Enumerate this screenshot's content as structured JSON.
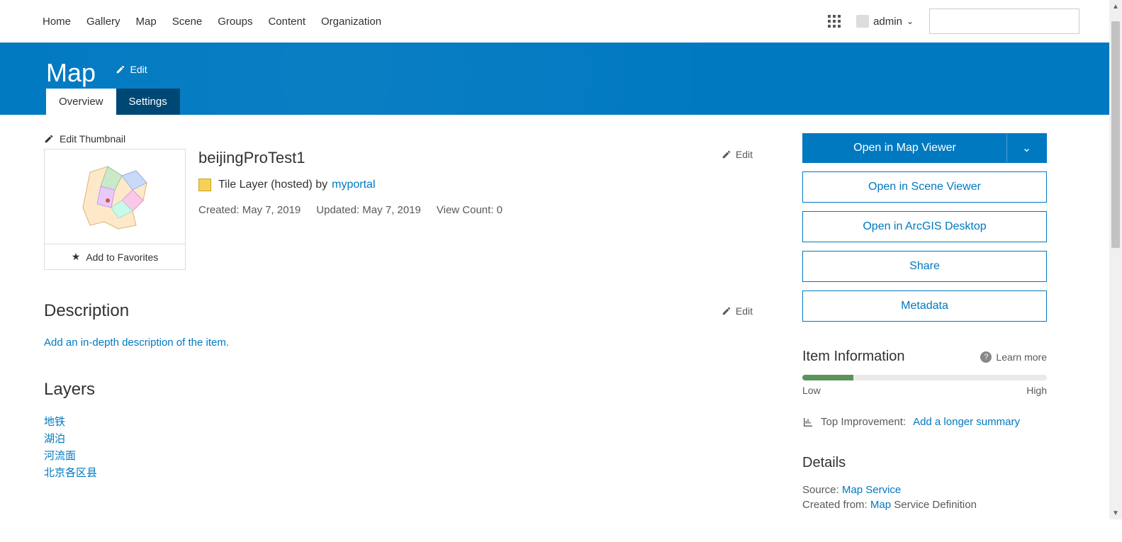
{
  "nav": [
    "Home",
    "Gallery",
    "Map",
    "Scene",
    "Groups",
    "Content",
    "Organization"
  ],
  "user": {
    "name": "admin"
  },
  "header": {
    "title": "Map",
    "edit": "Edit"
  },
  "tabs": [
    {
      "label": "Overview",
      "active": true
    },
    {
      "label": "Settings",
      "active": false
    }
  ],
  "editThumbnail": "Edit Thumbnail",
  "addToFavorites": "Add to Favorites",
  "item": {
    "title": "beijingProTest1",
    "type": "Tile Layer (hosted) by",
    "owner": "myportal",
    "createdLabel": "Created: May 7, 2019",
    "updatedLabel": "Updated: May 7, 2019",
    "viewCountLabel": "View Count: 0"
  },
  "editLabel": "Edit",
  "sections": {
    "description": {
      "title": "Description",
      "addLink": "Add an in-depth description of the item."
    },
    "layers": {
      "title": "Layers",
      "items": [
        "地铁",
        "湖泊",
        "河流面",
        "北京各区县"
      ]
    }
  },
  "actions": {
    "openMapViewer": "Open in Map Viewer",
    "openSceneViewer": "Open in Scene Viewer",
    "openDesktop": "Open in ArcGIS Desktop",
    "share": "Share",
    "metadata": "Metadata"
  },
  "info": {
    "title": "Item Information",
    "learnMore": "Learn more",
    "low": "Low",
    "high": "High",
    "progressPercent": 21,
    "topImprovementLabel": "Top Improvement:",
    "topImprovementLink": "Add a longer summary"
  },
  "details": {
    "title": "Details",
    "sourceLabel": "Source:",
    "sourceLink": "Map Service",
    "createdFromLabel": "Created from:",
    "createdFromLink": "Map",
    "createdFromAfter": "Service Definition"
  }
}
